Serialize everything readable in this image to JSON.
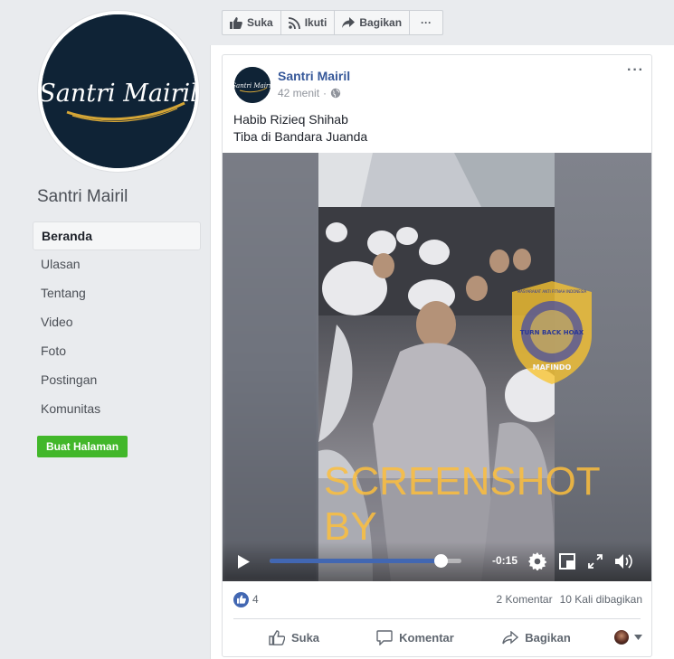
{
  "sidebar": {
    "logo_text": "Santri Mairil",
    "page_name": "Santri Mairil",
    "nav": [
      "Beranda",
      "Ulasan",
      "Tentang",
      "Video",
      "Foto",
      "Postingan",
      "Komunitas"
    ],
    "active_index": 0,
    "create_page_label": "Buat Halaman"
  },
  "actionbar": {
    "like_label": "Suka",
    "follow_label": "Ikuti",
    "share_label": "Bagikan",
    "more_label": "···"
  },
  "post": {
    "author": "Santri Mairil",
    "time": "42 menit",
    "privacy_icon": "globe-icon",
    "more_label": "···",
    "text_line1": "Habib Rizieq Shihab",
    "text_line2": "Tiba di Bandara Juanda",
    "video": {
      "time_remaining": "-0:15",
      "progress": 0.89,
      "seal_text_top": "MASYARAKAT ANTI FITNAH INDONESIA",
      "seal_center": "TURN BACK HOAX",
      "seal_bottom": "MAFINDO"
    },
    "watermark": "SCREENSHOT BY",
    "reaction_count": "4",
    "comments": "2 Komentar",
    "shares": "10 Kali dibagikan",
    "actions": {
      "like": "Suka",
      "comment": "Komentar",
      "share": "Bagikan"
    }
  },
  "colors": {
    "link": "#365899",
    "accent": "#4267b2",
    "green_button": "#42b72a",
    "watermark": "#fdbe3c"
  }
}
